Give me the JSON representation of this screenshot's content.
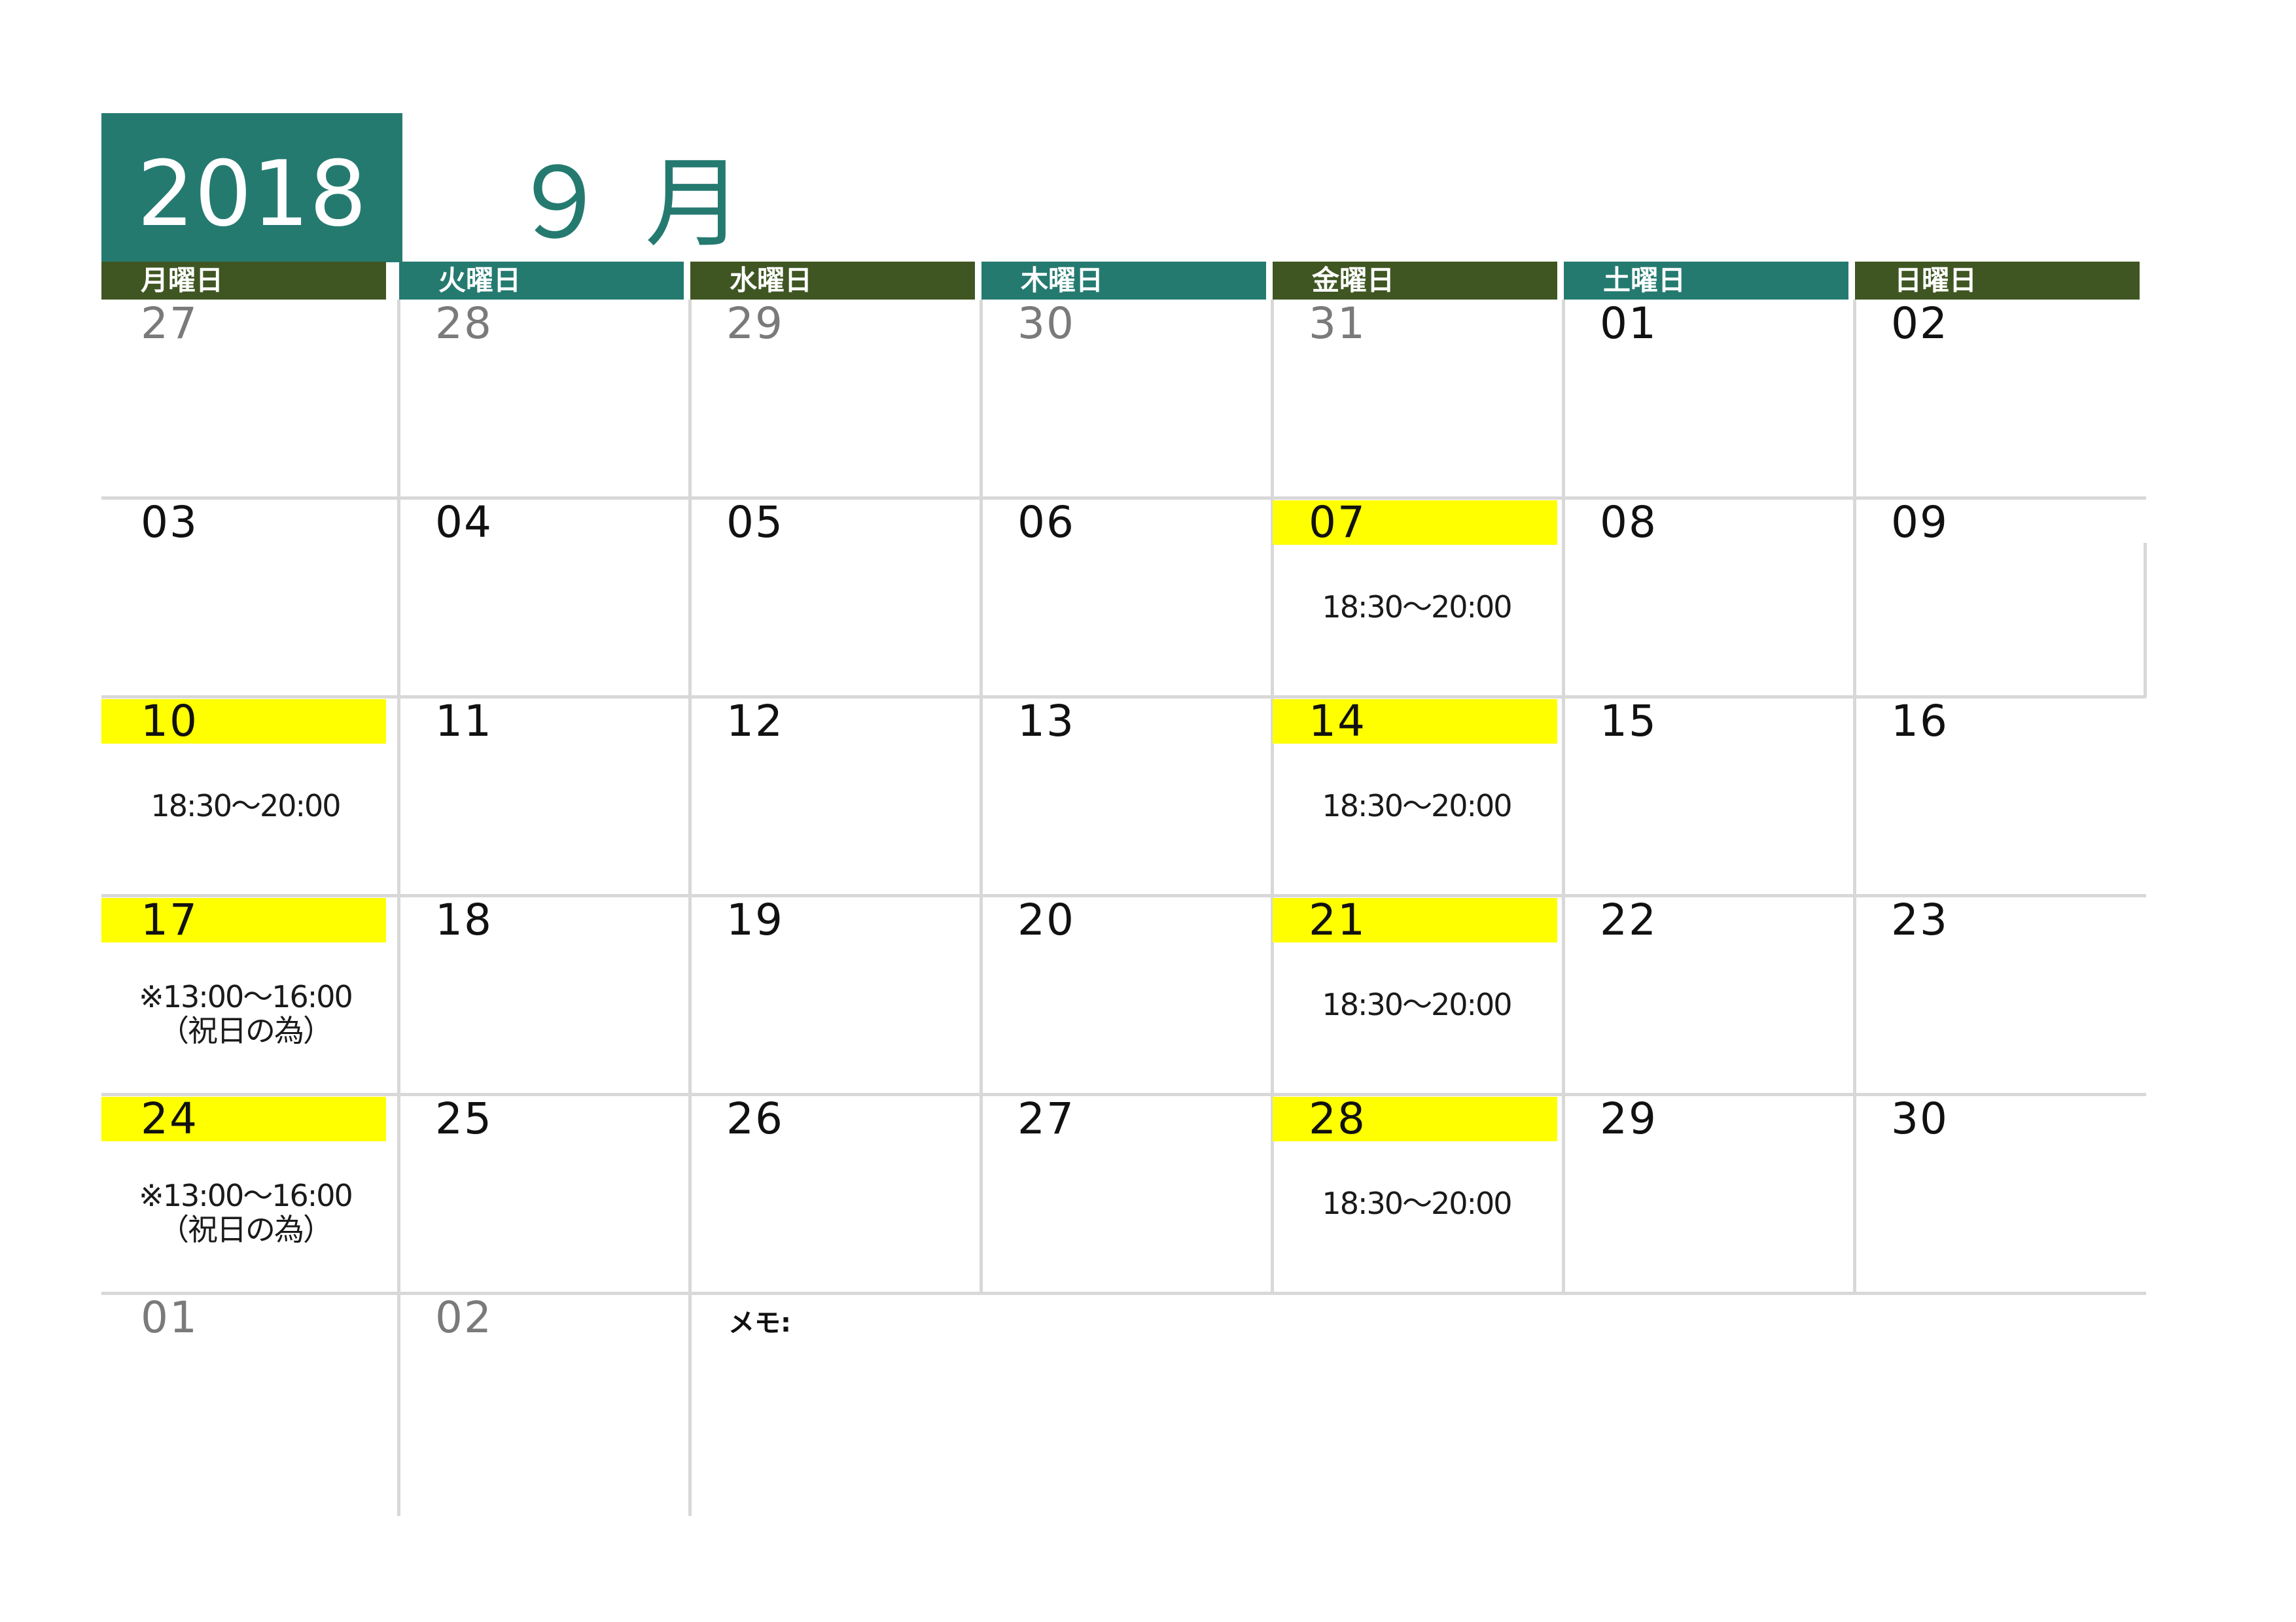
{
  "header": {
    "year": "2018",
    "month": "９ 月"
  },
  "colors": {
    "teal": "#257a70",
    "olive": "#3f5622",
    "highlight": "#ffff00",
    "muted": "#7a7a7a",
    "grid": "#d8d8d8"
  },
  "weekdays": [
    "月曜日",
    "火曜日",
    "水曜日",
    "木曜日",
    "金曜日",
    "土曜日",
    "日曜日"
  ],
  "weeks": [
    [
      {
        "day": "27",
        "muted": true
      },
      {
        "day": "28",
        "muted": true
      },
      {
        "day": "29",
        "muted": true
      },
      {
        "day": "30",
        "muted": true
      },
      {
        "day": "31",
        "muted": true
      },
      {
        "day": "01"
      },
      {
        "day": "02"
      }
    ],
    [
      {
        "day": "03"
      },
      {
        "day": "04"
      },
      {
        "day": "05"
      },
      {
        "day": "06"
      },
      {
        "day": "07",
        "highlight": true,
        "event": "18:30～20:00"
      },
      {
        "day": "08"
      },
      {
        "day": "09"
      }
    ],
    [
      {
        "day": "10",
        "highlight": true,
        "event": "18:30～20:00"
      },
      {
        "day": "11"
      },
      {
        "day": "12"
      },
      {
        "day": "13"
      },
      {
        "day": "14",
        "highlight": true,
        "event": "18:30～20:00"
      },
      {
        "day": "15"
      },
      {
        "day": "16"
      }
    ],
    [
      {
        "day": "17",
        "highlight": true,
        "event": "※13:00～16:00",
        "event_note": "（祝日の為）"
      },
      {
        "day": "18"
      },
      {
        "day": "19"
      },
      {
        "day": "20"
      },
      {
        "day": "21",
        "highlight": true,
        "event": "18:30～20:00"
      },
      {
        "day": "22"
      },
      {
        "day": "23"
      }
    ],
    [
      {
        "day": "24",
        "highlight": true,
        "event": "※13:00～16:00",
        "event_note": "（祝日の為）"
      },
      {
        "day": "25"
      },
      {
        "day": "26"
      },
      {
        "day": "27"
      },
      {
        "day": "28",
        "highlight": true,
        "event": "18:30～20:00"
      },
      {
        "day": "29"
      },
      {
        "day": "30"
      }
    ]
  ],
  "trailing": [
    {
      "day": "01",
      "muted": true
    },
    {
      "day": "02",
      "muted": true
    }
  ],
  "memo_label": "メモ:"
}
